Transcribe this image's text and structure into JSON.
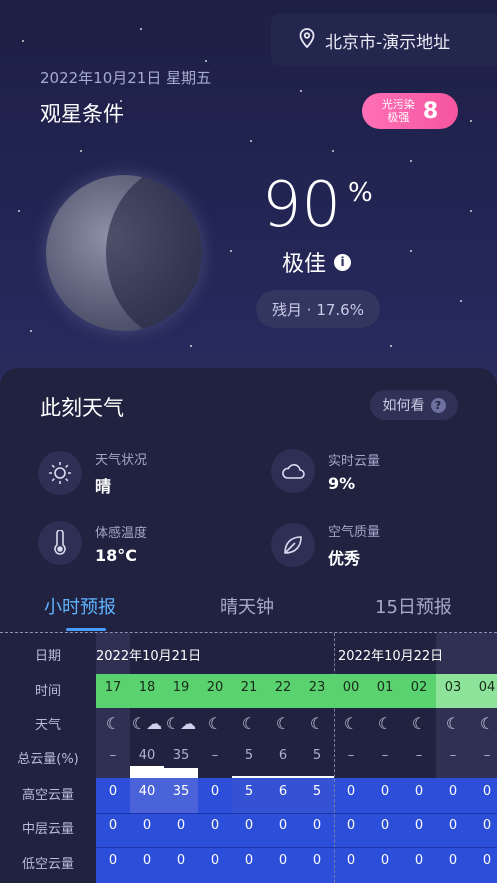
{
  "location": {
    "text": "北京市-演示地址"
  },
  "header": {
    "date": "2022年10月21日  星期五",
    "title": "观星条件"
  },
  "light_pollution": {
    "label_line1": "光污染",
    "label_line2": "极强",
    "value": "8",
    "color": "#f4569e"
  },
  "score": {
    "value": "90",
    "unit": "%",
    "verdict": "极佳",
    "info_icon": "i",
    "moon_phase": "残月 · 17.6%"
  },
  "weather_now": {
    "title": "此刻天气",
    "help_label": "如何看",
    "help_icon": "?",
    "items": [
      {
        "label": "天气状况",
        "value": "晴",
        "icon": "sun-icon"
      },
      {
        "label": "实时云量",
        "value": "9%",
        "icon": "cloud-icon"
      },
      {
        "label": "体感温度",
        "value": "18°C",
        "icon": "thermometer-icon"
      },
      {
        "label": "空气质量",
        "value": "优秀",
        "icon": "leaf-icon"
      }
    ]
  },
  "tabs": [
    {
      "label": "小时预报",
      "active": true
    },
    {
      "label": "晴天钟",
      "active": false
    },
    {
      "label": "15日预报",
      "active": false
    }
  ],
  "forecast": {
    "row_labels": [
      "日期",
      "时间",
      "天气",
      "总云量(%)",
      "高空云量",
      "中层云量",
      "低空云量"
    ],
    "date_labels": [
      "2022年10月21日",
      "2022年10月22日"
    ],
    "hours": [
      "17",
      "18",
      "19",
      "20",
      "21",
      "22",
      "23",
      "00",
      "01",
      "02",
      "03",
      "04"
    ],
    "weather_icons": [
      "moon",
      "moon-cloud",
      "moon-cloud",
      "moon",
      "moon",
      "moon",
      "moon",
      "moon",
      "moon",
      "moon",
      "moon",
      "moon"
    ],
    "total_cloud": [
      "–",
      "40",
      "35",
      "–",
      "5",
      "6",
      "5",
      "–",
      "–",
      "–",
      "–",
      "–"
    ],
    "high_cloud": [
      "0",
      "40",
      "35",
      "0",
      "5",
      "6",
      "5",
      "0",
      "0",
      "0",
      "0",
      "0"
    ],
    "mid_cloud": [
      "0",
      "0",
      "0",
      "0",
      "0",
      "0",
      "0",
      "0",
      "0",
      "0",
      "0",
      "0"
    ],
    "low_cloud": [
      "0",
      "0",
      "0",
      "0",
      "0",
      "0",
      "0",
      "0",
      "0",
      "0",
      "0",
      "0"
    ],
    "colors": {
      "good": "#5ad26f",
      "good_light": "#8ee39b",
      "cloud_band": "#2c4ed8",
      "cloud_band_mid": "#2742c8"
    }
  }
}
